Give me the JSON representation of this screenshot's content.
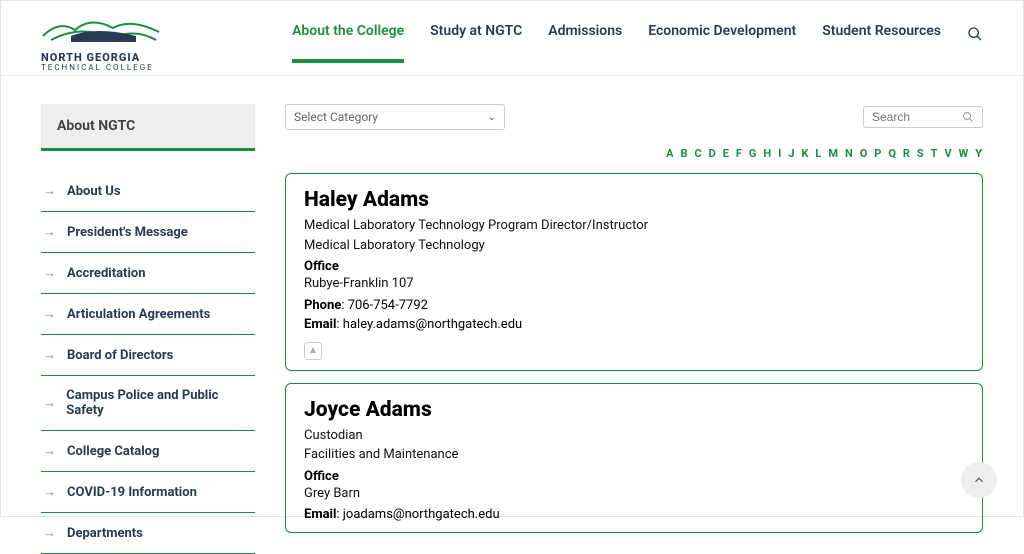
{
  "logo": {
    "line1": "NORTH GEORGIA",
    "line2": "TECHNICAL COLLEGE"
  },
  "nav": {
    "items": [
      {
        "label": "About the College",
        "active": true
      },
      {
        "label": "Study at NGTC",
        "active": false
      },
      {
        "label": "Admissions",
        "active": false
      },
      {
        "label": "Economic Development",
        "active": false
      },
      {
        "label": "Student Resources",
        "active": false
      }
    ]
  },
  "sidebar": {
    "title": "About NGTC",
    "items": [
      {
        "label": "About Us"
      },
      {
        "label": "President's Message"
      },
      {
        "label": "Accreditation"
      },
      {
        "label": "Articulation Agreements"
      },
      {
        "label": "Board of Directors"
      },
      {
        "label": "Campus Police and Public Safety"
      },
      {
        "label": "College Catalog"
      },
      {
        "label": "COVID-19 Information"
      },
      {
        "label": "Departments"
      }
    ]
  },
  "main": {
    "category_placeholder": "Select Category",
    "search_placeholder": "Search",
    "alpha": [
      "A",
      "B",
      "C",
      "D",
      "E",
      "F",
      "G",
      "H",
      "I",
      "J",
      "K",
      "L",
      "M",
      "N",
      "O",
      "P",
      "Q",
      "R",
      "S",
      "T",
      "V",
      "W",
      "Y"
    ],
    "labels": {
      "office": "Office",
      "phone": "Phone",
      "email": "Email"
    },
    "persons": [
      {
        "name": "Haley Adams",
        "title": "Medical Laboratory Technology Program Director/Instructor",
        "dept": "Medical Laboratory Technology",
        "office": "Rubye-Franklin 107",
        "phone": "706-754-7792",
        "email": "haley.adams@northgatech.edu"
      },
      {
        "name": "Joyce Adams",
        "title": "Custodian",
        "dept": "Facilities and Maintenance",
        "office": "Grey Barn",
        "email": "joadams@northgatech.edu"
      }
    ]
  }
}
